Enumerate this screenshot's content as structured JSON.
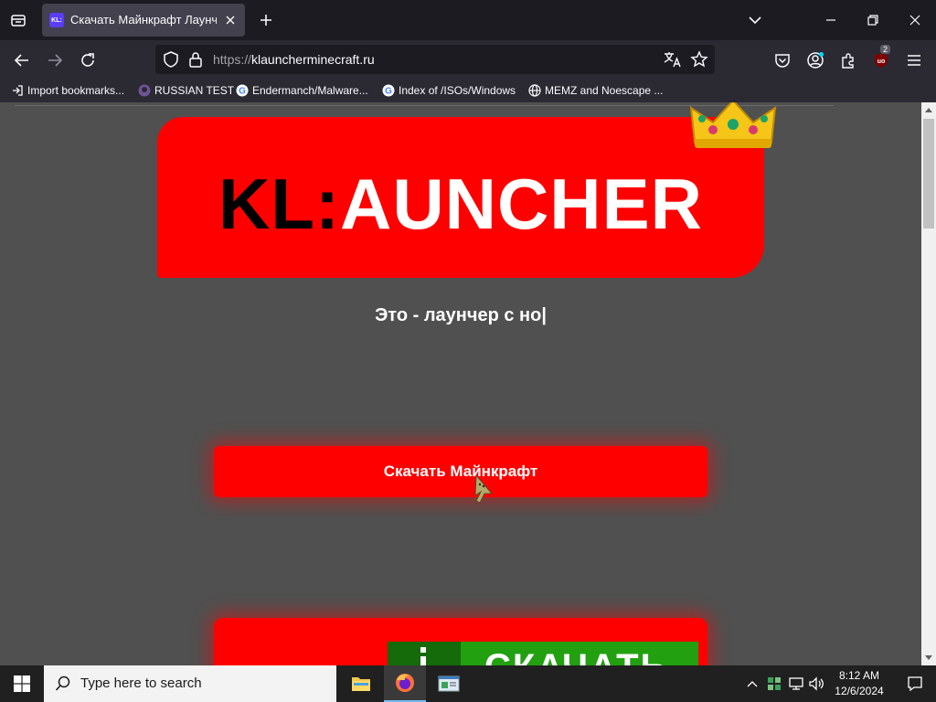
{
  "browser": {
    "tab": {
      "title": "Скачать Майнкрафт Лаунчер",
      "favicon_text": "KL:",
      "icons": {
        "close": "close-icon",
        "new_tab": "plus-icon",
        "tab_list": "tab-list-icon"
      }
    },
    "window_controls": [
      "chevron-down-icon",
      "minimize-icon",
      "restore-icon",
      "close-icon"
    ],
    "url": {
      "scheme": "https://",
      "host": "klauncherminecraft.ru"
    },
    "nav_icons": [
      "back-arrow-icon",
      "forward-arrow-icon",
      "reload-icon",
      "shield-icon",
      "lock-icon",
      "translate-icon",
      "star-icon",
      "pocket-icon",
      "account-icon",
      "extensions-icon",
      "ublock-icon",
      "menu-icon"
    ],
    "extension_badge": "2",
    "bookmarks": [
      {
        "label": "Import bookmarks...",
        "icon": "import-icon"
      },
      {
        "label": "RUSSIAN TEST",
        "icon": "github-icon"
      },
      {
        "label": "Endermanch/Malware...",
        "icon": "google-icon"
      },
      {
        "label": "Index of /ISOs/Windows",
        "icon": "google-icon"
      },
      {
        "label": "MEMZ and Noescape ...",
        "icon": "globe-icon"
      }
    ]
  },
  "page": {
    "logo": {
      "part1": "KL",
      "part2": ":",
      "part3": "AUNCHER"
    },
    "tagline": "Это - лаунчер с но|",
    "download_button": "Скачать Майнкрафт",
    "banner_text": "СКАЧАТЬ",
    "colors": {
      "background": "#505050",
      "accent": "#ff0000",
      "banner_green": "#22a010"
    }
  },
  "taskbar": {
    "search_placeholder": "Type here to search",
    "apps": [
      "file-explorer-icon",
      "firefox-icon",
      "app-window-icon"
    ],
    "time": "8:12 AM",
    "date": "12/6/2024",
    "tray_icons": [
      "chevron-up-icon",
      "tray-app-icon",
      "network-icon",
      "volume-icon",
      "notification-icon"
    ]
  }
}
